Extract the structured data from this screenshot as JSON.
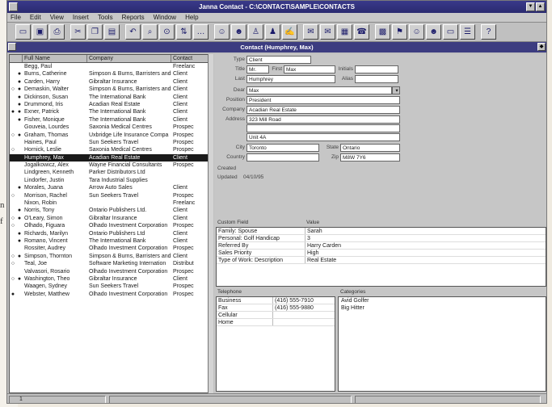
{
  "app": {
    "title": "Janna Contact - C:\\CONTACT\\SAMPLE\\CONTACTS"
  },
  "menu": [
    "File",
    "Edit",
    "View",
    "Insert",
    "Tools",
    "Reports",
    "Window",
    "Help"
  ],
  "window": {
    "title": "Contact (Humphrey, Max)"
  },
  "margin_text": [
    "n",
    "f"
  ],
  "list": {
    "headers": [
      "Full Name",
      "Company",
      "Contact"
    ],
    "rows": [
      {
        "flag": "",
        "dot": "",
        "name": "Begg, Paul",
        "company": "",
        "type": "Freelanc"
      },
      {
        "flag": "",
        "dot": "●",
        "name": "Burns, Catherine",
        "company": "Simpson & Burns, Barristers and",
        "type": "Client"
      },
      {
        "flag": "",
        "dot": "●",
        "name": "Carden, Harry",
        "company": "Gibraltar Insurance",
        "type": "Client"
      },
      {
        "flag": "○",
        "dot": "●",
        "name": "Demaskin, Walter",
        "company": "Simpson & Burns, Barristers and",
        "type": "Client"
      },
      {
        "flag": "",
        "dot": "●",
        "name": "Dickinson, Susan",
        "company": "The International Bank",
        "type": "Client"
      },
      {
        "flag": "",
        "dot": "●",
        "name": "Drummond, Iris",
        "company": "Acadian Real Estate",
        "type": "Client"
      },
      {
        "flag": "●",
        "dot": "●",
        "name": "Exner, Patrick",
        "company": "The International Bank",
        "type": "Client"
      },
      {
        "flag": "",
        "dot": "●",
        "name": "Fisher, Monique",
        "company": "The International Bank",
        "type": "Client"
      },
      {
        "flag": "",
        "dot": "",
        "name": "Gouveia, Lourdes",
        "company": "Saxonia Medical Centres",
        "type": "Prospec"
      },
      {
        "flag": "○",
        "dot": "●",
        "name": "Graham, Thomas",
        "company": "Uxbridge Life Insurance Compa",
        "type": "Prospec"
      },
      {
        "flag": "",
        "dot": "",
        "name": "Haines, Paul",
        "company": "Sun Seekers Travel",
        "type": "Prospec"
      },
      {
        "flag": "○",
        "dot": "",
        "name": "Hornick, Leslie",
        "company": "Saxonia Medical Centres",
        "type": "Prospec"
      },
      {
        "flag": "",
        "dot": "",
        "name": "Humphrey, Max",
        "company": "Acadian Real Estate",
        "type": "Client",
        "selected": true
      },
      {
        "flag": "",
        "dot": "",
        "name": "Jogalkowicz, Alex",
        "company": "Wayne Financial Consultants",
        "type": "Prospec"
      },
      {
        "flag": "",
        "dot": "",
        "name": "Lindgreen, Kenneth",
        "company": "Parker Distributors Ltd",
        "type": ""
      },
      {
        "flag": "",
        "dot": "",
        "name": "Lindorfer, Justin",
        "company": "Tara Industrial Supplies",
        "type": ""
      },
      {
        "flag": "",
        "dot": "●",
        "name": "Morales, Juana",
        "company": "Arrow Auto Sales",
        "type": "Client"
      },
      {
        "flag": "○",
        "dot": "",
        "name": "Morrison, Rachel",
        "company": "Sun Seekers Travel",
        "type": "Prospec"
      },
      {
        "flag": "",
        "dot": "",
        "name": "Nixon, Robin",
        "company": "",
        "type": "Freelanc"
      },
      {
        "flag": "",
        "dot": "●",
        "name": "Norris, Tony",
        "company": "Ontario Publishers Ltd.",
        "type": "Client"
      },
      {
        "flag": "○",
        "dot": "●",
        "name": "O'Leary, Simon",
        "company": "Gibraltar Insurance",
        "type": "Client"
      },
      {
        "flag": "○",
        "dot": "",
        "name": "Olhado, Figuara",
        "company": "Olhado Investment Corporation",
        "type": "Prospec"
      },
      {
        "flag": "",
        "dot": "●",
        "name": "Richards, Marilyn",
        "company": "Ontario Publishers Ltd",
        "type": "Client"
      },
      {
        "flag": "",
        "dot": "●",
        "name": "Romano, Vincent",
        "company": "The International Bank",
        "type": "Client"
      },
      {
        "flag": "",
        "dot": "",
        "name": "Rossiter, Audrey",
        "company": "Olhado Investment Corporation",
        "type": "Prospec"
      },
      {
        "flag": "○",
        "dot": "●",
        "name": "Simpson, Thornton",
        "company": "Simpson & Burns, Barristers and",
        "type": "Client"
      },
      {
        "flag": "○",
        "dot": "",
        "name": "Teal, Joe",
        "company": "Software Marketing Internation",
        "type": "Distribut"
      },
      {
        "flag": "",
        "dot": "",
        "name": "Valvasori, Rosario",
        "company": "Olhado Investment Corporation",
        "type": "Prospec"
      },
      {
        "flag": "○",
        "dot": "●",
        "name": "Washington, Theo",
        "company": "Gibraltar Insurance",
        "type": "Client"
      },
      {
        "flag": "",
        "dot": "",
        "name": "Waagen, Sydney",
        "company": "Sun Seekers Travel",
        "type": "Prospec"
      },
      {
        "flag": "●",
        "dot": "",
        "name": "Webster, Matthew",
        "company": "Olhado Investment Corporation",
        "type": "Prospec"
      }
    ]
  },
  "detail": {
    "type_label": "Type",
    "type_value": "Client",
    "title_label": "Title",
    "title_value": "Mr.",
    "first_label": "First",
    "first_value": "Max",
    "initials_label": "Initials",
    "initials_value": "",
    "last_label": "Last",
    "last_value": "Humphrey",
    "alias_label": "Alias",
    "alias_value": "",
    "dear_label": "Dear",
    "dear_value": "Max",
    "position_label": "Position",
    "position_value": "President",
    "company_label": "Company",
    "company_value": "Acadian Real Estate",
    "address_label": "Address",
    "address_line1": "323 Mill Road",
    "address_line2": "",
    "address_line3": "Unit 4A",
    "city_label": "City",
    "city_value": "Toronto",
    "state_label": "State",
    "state_value": "Ontario",
    "country_label": "Country",
    "country_value": "",
    "zip_label": "Zip",
    "zip_value": "M8W 7Y6",
    "created_label": "Created",
    "created_value": "",
    "updated_label": "Updated",
    "updated_value": "04/10/95"
  },
  "custom": {
    "headers": [
      "Custom Field",
      "Value"
    ],
    "rows": [
      [
        "Family: Spouse",
        "Sarah"
      ],
      [
        "Personal: Golf Handicap",
        "3"
      ],
      [
        "Referred By",
        "Harry Carden"
      ],
      [
        "Sales Priority",
        "High"
      ],
      [
        "Type of Work: Description",
        "Real Estate"
      ]
    ]
  },
  "phones": {
    "headers": [
      "Telephone",
      "Categories"
    ],
    "rows": [
      [
        "Business",
        "(416) 555-7910"
      ],
      [
        "Fax",
        "(416) 555-9880"
      ],
      [
        "Cellular",
        ""
      ],
      [
        "Home",
        ""
      ]
    ],
    "categories": [
      "Avid Golfer",
      "Big Hitter"
    ]
  },
  "status": {
    "page": "1"
  }
}
